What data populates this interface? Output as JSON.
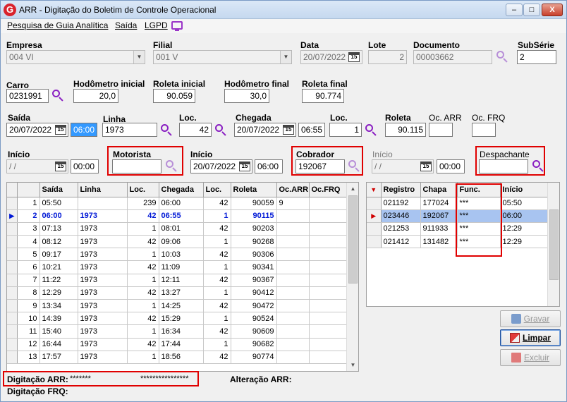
{
  "window": {
    "title": "ARR - Digitação do Boletim de Controle Operacional",
    "app_icon": "G",
    "minimize": "–",
    "maximize": "□",
    "close": "X"
  },
  "menu": {
    "items": [
      "Pesquisa de Guia Analítica",
      "Saída",
      "LGPD"
    ]
  },
  "row1": {
    "empresa_label": "Empresa",
    "empresa_value": "004 VI",
    "filial_label": "Filial",
    "filial_value": "001 V",
    "data_label": "Data",
    "data_value": "20/07/2022",
    "lote_label": "Lote",
    "lote_value": "2",
    "documento_label": "Documento",
    "documento_value": "00003662",
    "subserie_label": "SubSérie",
    "subserie_value": "2"
  },
  "row2": {
    "carro_label": "Carro",
    "carro_value": "0231991",
    "hod_ini_label": "Hodômetro inicial",
    "hod_ini_value": "20,0",
    "rol_ini_label": "Roleta inicial",
    "rol_ini_value": "90.059",
    "hod_fin_label": "Hodômetro final",
    "hod_fin_value": "30,0",
    "rol_fin_label": "Roleta final",
    "rol_fin_value": "90.774"
  },
  "row3": {
    "saida_label": "Saída",
    "saida_date": "20/07/2022",
    "saida_time": "06:00",
    "linha_label": "Linha",
    "linha_value": "1973",
    "loc_label": "Loc.",
    "loc_value": "42",
    "chegada_label": "Chegada",
    "chegada_date": "20/07/2022",
    "chegada_time": "06:55",
    "loc2_label": "Loc.",
    "loc2_value": "1",
    "roleta_label": "Roleta",
    "roleta_value": "90.115",
    "ocarr_label": "Oc. ARR",
    "ocarr_value": "",
    "ocfrq_label": "Oc. FRQ",
    "ocfrq_value": ""
  },
  "row4": {
    "inicio_label": "Início",
    "inicio_date": " / /",
    "inicio_time": "00:00",
    "motorista_label": "Motorista",
    "motorista_value": "",
    "inicio2_label": "Início",
    "inicio2_date": "20/07/2022",
    "inicio2_time": "06:00",
    "cobrador_label": "Cobrador",
    "cobrador_value": "192067",
    "inicio3_label": "Início",
    "inicio3_date": " / /",
    "inicio3_time": "00:00",
    "despachante_label": "Despachante",
    "despachante_value": ""
  },
  "left_grid": {
    "columns": [
      "",
      "Saída",
      "Linha",
      "Loc.",
      "Chegada",
      "Loc.",
      "Roleta",
      "Oc.ARR",
      "Oc.FRQ"
    ],
    "rows": [
      [
        "1",
        "05:50",
        "",
        "239",
        "06:00",
        "42",
        "90059",
        "9",
        ""
      ],
      [
        "2",
        "06:00",
        "1973",
        "42",
        "06:55",
        "1",
        "90115",
        "",
        ""
      ],
      [
        "3",
        "07:13",
        "1973",
        "1",
        "08:01",
        "42",
        "90203",
        "",
        ""
      ],
      [
        "4",
        "08:12",
        "1973",
        "42",
        "09:06",
        "1",
        "90268",
        "",
        ""
      ],
      [
        "5",
        "09:17",
        "1973",
        "1",
        "10:03",
        "42",
        "90306",
        "",
        ""
      ],
      [
        "6",
        "10:21",
        "1973",
        "42",
        "11:09",
        "1",
        "90341",
        "",
        ""
      ],
      [
        "7",
        "11:22",
        "1973",
        "1",
        "12:11",
        "42",
        "90367",
        "",
        ""
      ],
      [
        "8",
        "12:29",
        "1973",
        "42",
        "13:27",
        "1",
        "90412",
        "",
        ""
      ],
      [
        "9",
        "13:34",
        "1973",
        "1",
        "14:25",
        "42",
        "90472",
        "",
        ""
      ],
      [
        "10",
        "14:39",
        "1973",
        "42",
        "15:29",
        "1",
        "90524",
        "",
        ""
      ],
      [
        "11",
        "15:40",
        "1973",
        "1",
        "16:34",
        "42",
        "90609",
        "",
        ""
      ],
      [
        "12",
        "16:44",
        "1973",
        "42",
        "17:44",
        "1",
        "90682",
        "",
        ""
      ],
      [
        "13",
        "17:57",
        "1973",
        "1",
        "18:56",
        "42",
        "90774",
        "",
        ""
      ]
    ]
  },
  "right_grid": {
    "columns": [
      "",
      "Registro",
      "Chapa",
      "Func.",
      "Início"
    ],
    "rows": [
      [
        "021192",
        "177024",
        "***",
        "05:50"
      ],
      [
        "023446",
        "192067",
        "***",
        "06:00"
      ],
      [
        "021253",
        "911933",
        "***",
        "12:29"
      ],
      [
        "021412",
        "131482",
        "***",
        "12:29"
      ]
    ]
  },
  "buttons": {
    "gravar": "Gravar",
    "limpar": "Limpar",
    "excluir": "Excluir"
  },
  "footer": {
    "digitacao_arr_label": "Digitação ARR:",
    "digitacao_arr_v1": "*******",
    "digitacao_arr_v2": "****************",
    "alteracao_arr_label": "Alteração ARR:",
    "digitacao_frq_label": "Digitação FRQ:"
  }
}
